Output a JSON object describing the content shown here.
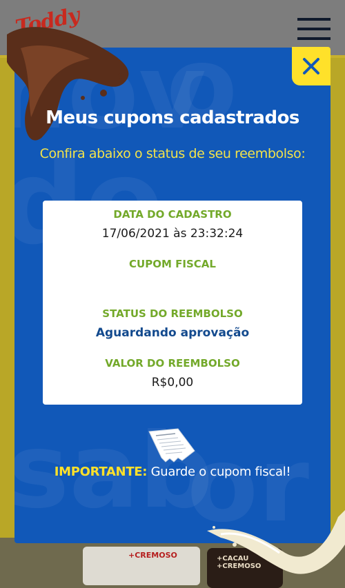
{
  "background": {
    "brand": "Toddy",
    "product_1_text": "+CREMOSO",
    "product_2_text": "+CACAU +CREMOSO"
  },
  "modal": {
    "title": "Meus cupons cadastrados",
    "subtitle": "Confira abaixo o status de seu reembolso:",
    "fields": {
      "date_label": "DATA DO CADASTRO",
      "date_value": "17/06/2021 às 23:32:24",
      "coupon_label": "CUPOM FISCAL",
      "coupon_value": "",
      "status_label": "STATUS DO REEMBOLSO",
      "status_value": "Aguardando aprovação",
      "amount_label": "VALOR DO REEMBOLSO",
      "amount_value": "R$0,00"
    },
    "important_prefix": "IMPORTANTE:",
    "important_text": " Guarde o cupom fiscal!"
  },
  "colors": {
    "modal_bg": "#1158b8",
    "accent_yellow": "#ffe12a",
    "label_green": "#73a92a",
    "status_blue": "#134a8e"
  },
  "icons": {
    "menu": "hamburger-menu-icon",
    "close": "close-icon",
    "receipt": "receipt-icon"
  }
}
